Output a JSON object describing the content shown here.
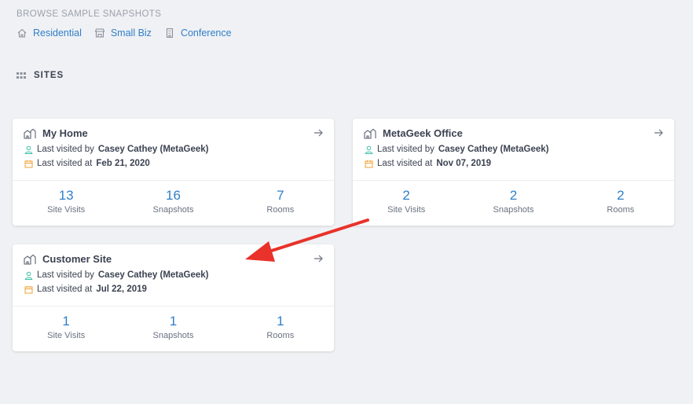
{
  "browse": {
    "title": "BROWSE SAMPLE SNAPSHOTS",
    "links": [
      {
        "label": "Residential",
        "icon": "home-icon"
      },
      {
        "label": "Small Biz",
        "icon": "store-icon"
      },
      {
        "label": "Conference",
        "icon": "building-icon"
      }
    ]
  },
  "sites_header": "SITES",
  "cards": [
    {
      "title": "My Home",
      "visited_by_prefix": "Last visited by",
      "visited_by": "Casey Cathey (MetaGeek)",
      "visited_at_prefix": "Last visited at",
      "visited_at": "Feb 21, 2020",
      "stats": [
        {
          "value": "13",
          "label": "Site Visits"
        },
        {
          "value": "16",
          "label": "Snapshots"
        },
        {
          "value": "7",
          "label": "Rooms"
        }
      ]
    },
    {
      "title": "MetaGeek Office",
      "visited_by_prefix": "Last visited by",
      "visited_by": "Casey Cathey (MetaGeek)",
      "visited_at_prefix": "Last visited at",
      "visited_at": "Nov 07, 2019",
      "stats": [
        {
          "value": "2",
          "label": "Site Visits"
        },
        {
          "value": "2",
          "label": "Snapshots"
        },
        {
          "value": "2",
          "label": "Rooms"
        }
      ]
    },
    {
      "title": "Customer Site",
      "visited_by_prefix": "Last visited by",
      "visited_by": "Casey Cathey (MetaGeek)",
      "visited_at_prefix": "Last visited at",
      "visited_at": "Jul 22, 2019",
      "stats": [
        {
          "value": "1",
          "label": "Site Visits"
        },
        {
          "value": "1",
          "label": "Snapshots"
        },
        {
          "value": "1",
          "label": "Rooms"
        }
      ]
    }
  ],
  "colors": {
    "accent": "#2f7fc9",
    "user_icon": "#3bbfa8",
    "calendar_icon": "#f0a030",
    "annotation_arrow": "#e8322a"
  }
}
